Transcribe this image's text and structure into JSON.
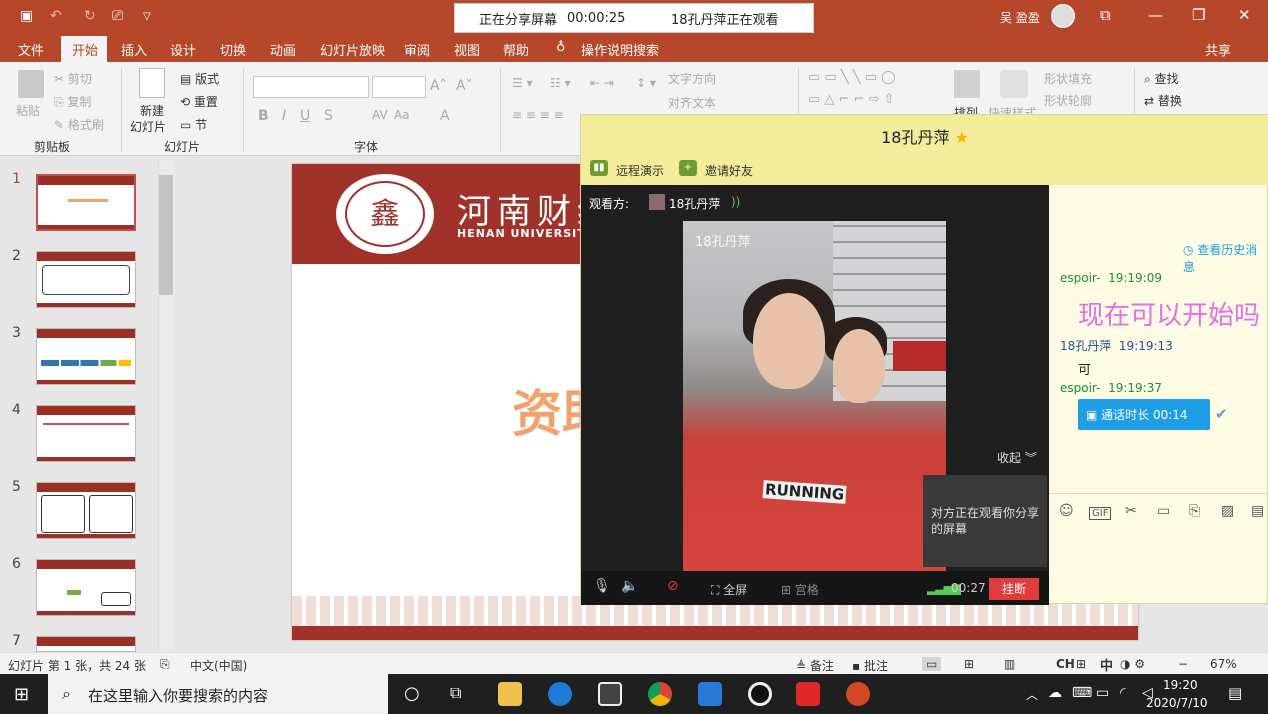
{
  "titlebar": {
    "quick_access": [
      "save-icon",
      "undo-icon",
      "redo-icon",
      "present-icon",
      "customize-icon"
    ],
    "share_banner": {
      "status": "正在分享屏幕",
      "elapsed": "00:00:25",
      "viewer_status": "18孔丹萍正在观看"
    },
    "user_name": "吴 盈盈"
  },
  "menu": {
    "tabs": [
      "文件",
      "开始",
      "插入",
      "设计",
      "切换",
      "动画",
      "幻灯片放映",
      "审阅",
      "视图",
      "帮助"
    ],
    "tell_me": "操作说明搜索",
    "share": "共享"
  },
  "ribbon": {
    "clipboard": {
      "paste": "粘贴",
      "cut": "剪切",
      "copy": "复制",
      "format_painter": "格式刷",
      "label": "剪贴板"
    },
    "slides": {
      "new_slide_1": "新建",
      "new_slide_2": "幻灯片",
      "layout": "版式",
      "reset": "重置",
      "section": "节",
      "label": "幻灯片"
    },
    "font": {
      "bold": "B",
      "italic": "I",
      "underline": "U",
      "shadow": "S",
      "spacing": "AV",
      "case": "Aa",
      "color": "A",
      "label": "字体"
    },
    "paragraph": {
      "text_direction": "文字方向",
      "align_text": "对齐文本"
    },
    "drawing": {
      "arrange": "排列",
      "quick_styles": "快速样式",
      "shape_fill": "形状填充",
      "shape_outline": "形状轮廓"
    },
    "editing": {
      "find": "查找",
      "replace": "替换"
    }
  },
  "thumbnails": [
    "1",
    "2",
    "3",
    "4",
    "5",
    "6",
    "7"
  ],
  "slide": {
    "uni_cn": "河南财经",
    "uni_en": "HENAN UNIVERSITY",
    "seal_char": "鑫",
    "title": "资助"
  },
  "chat": {
    "title": "18孔丹萍",
    "toolbar": {
      "remote": "远程演示",
      "invite": "邀请好友"
    },
    "viewer_label": "观看方:",
    "viewer_name": "18孔丹萍",
    "feed_name": "18孔丹萍",
    "shirt_text": "RUNNING",
    "collapse": "收起",
    "notice": "对方正在观看你分享的屏幕",
    "controls": {
      "fullscreen": "全屏",
      "grid": "宫格",
      "duration": "00:27",
      "hangup": "挂断"
    },
    "history_link": "查看历史消息",
    "messages": [
      {
        "sender": "espoir-",
        "time": "19:19:09",
        "text": "现在可以开始吗"
      },
      {
        "sender": "18孔丹萍",
        "time": "19:19:13",
        "text": "可"
      },
      {
        "sender": "espoir-",
        "time": "19:19:37",
        "text": "通话时长 00:14"
      }
    ],
    "input_tools": [
      "emoji-icon",
      "gif-icon",
      "scissors-icon",
      "folder-icon",
      "doc-icon",
      "image-icon",
      "more-icon"
    ]
  },
  "statusbar": {
    "slide_info": "幻灯片 第 1 张，共 24 张",
    "language": "中文(中国)",
    "notes": "备注",
    "comments": "批注",
    "ime": "CH",
    "ime2": "中",
    "zoom": "67%"
  },
  "taskbar": {
    "search_placeholder": "在这里输入你要搜索的内容",
    "time": "19:20",
    "date": "2020/7/10",
    "apps": [
      "file-explorer-icon",
      "edge-icon",
      "store-icon",
      "chrome-icon",
      "mail-icon",
      "qq-icon",
      "video-icon",
      "powerpoint-icon"
    ]
  },
  "colors": {
    "accent": "#b7472a",
    "slide_red": "#a0322a",
    "chat_yellow": "#f3ec9a",
    "call_blue": "#1e9fe5",
    "hangup_red": "#e23b3b",
    "msg_pink": "#e36fe3"
  }
}
